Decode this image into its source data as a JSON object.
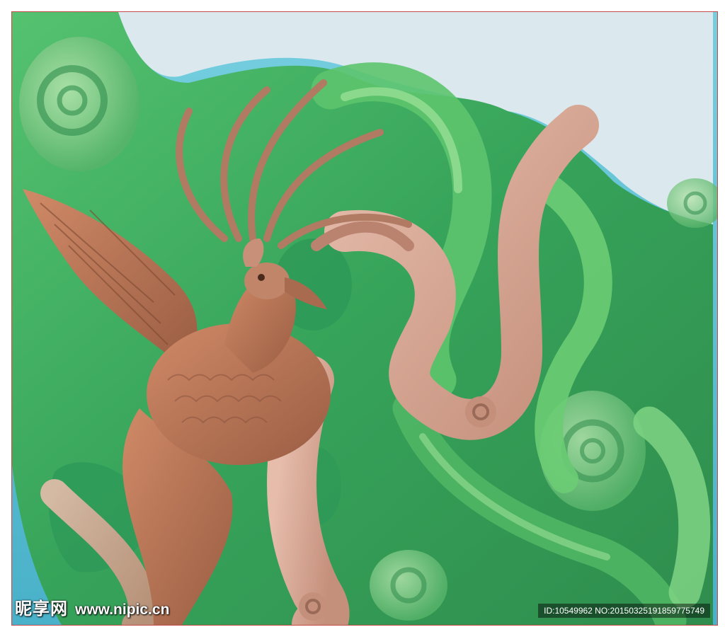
{
  "image": {
    "subject": "phoenix",
    "style": "carved relief rendering"
  },
  "watermark": {
    "site_name": "昵享网",
    "url": "www.nipic.cn",
    "id_text": "ID:10549962 NO:20150325191859775749"
  },
  "colors": {
    "background_cyan": "#5fc4d8",
    "relief_green": "#3fae62",
    "bird_brown": "#b9775a",
    "ribbon_pink": "#d8a896",
    "sky_pale": "#dbe9ee",
    "frame_border": "#c44a4a"
  }
}
